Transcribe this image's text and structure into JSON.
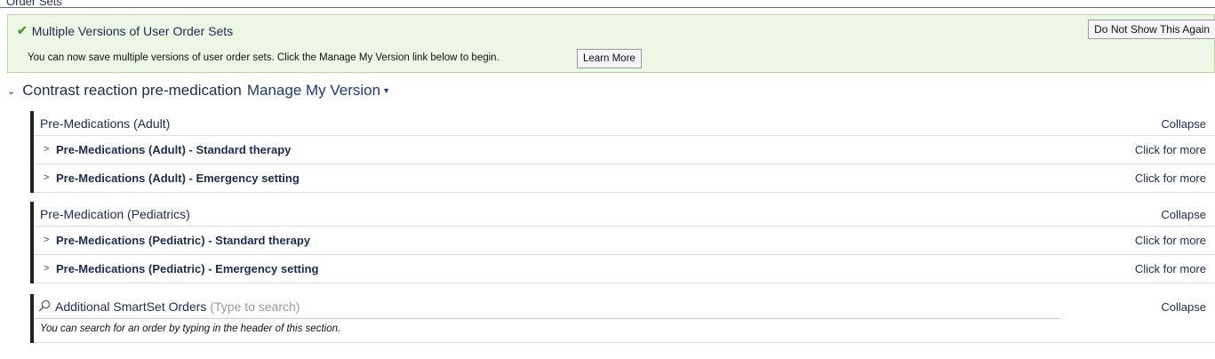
{
  "header": {
    "title": "Order Sets"
  },
  "banner": {
    "title": "Multiple Versions of User Order Sets",
    "dismiss_label": "Do Not Show This Again",
    "message": "You can now save multiple versions of user order sets. Click the Manage My Version link below to begin.",
    "learn_more_label": "Learn More",
    "accent_color": "#4c9a2a"
  },
  "order_set": {
    "title": "Contrast reaction pre-medication",
    "manage_label": "Manage My Version"
  },
  "sections": [
    {
      "title": "Pre-Medications (Adult)",
      "collapse_label": "Collapse",
      "rows": [
        {
          "label": "Pre-Medications (Adult) - Standard therapy",
          "action": "Click for more"
        },
        {
          "label": "Pre-Medications (Adult) - Emergency setting",
          "action": "Click for more"
        }
      ]
    },
    {
      "title": "Pre-Medication (Pediatrics)",
      "collapse_label": "Collapse",
      "rows": [
        {
          "label": "Pre-Medications (Pediatric) - Standard therapy",
          "action": "Click for more"
        },
        {
          "label": "Pre-Medications (Pediatric) - Emergency setting",
          "action": "Click for more"
        }
      ]
    }
  ],
  "search_section": {
    "title": "Additional SmartSet Orders",
    "placeholder": "(Type to search)",
    "collapse_label": "Collapse",
    "note": "You can search for an order by typing in the header of this section.",
    "icon": "search-icon"
  }
}
